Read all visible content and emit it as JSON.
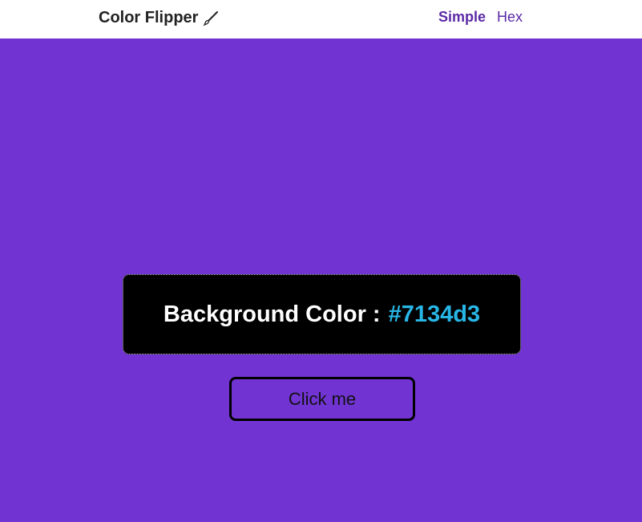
{
  "navbar": {
    "brand": "Color Flipper",
    "brand_icon": "paintbrush-icon",
    "links": [
      {
        "label": "Simple",
        "active": true
      },
      {
        "label": "Hex",
        "active": false
      }
    ]
  },
  "main": {
    "label": "Background Color :",
    "color_value": "#7134d3",
    "button_label": "Click me"
  },
  "colors": {
    "background": "#7134d3",
    "accent": "#28b6e6",
    "nav_link": "#5b2aa6"
  }
}
